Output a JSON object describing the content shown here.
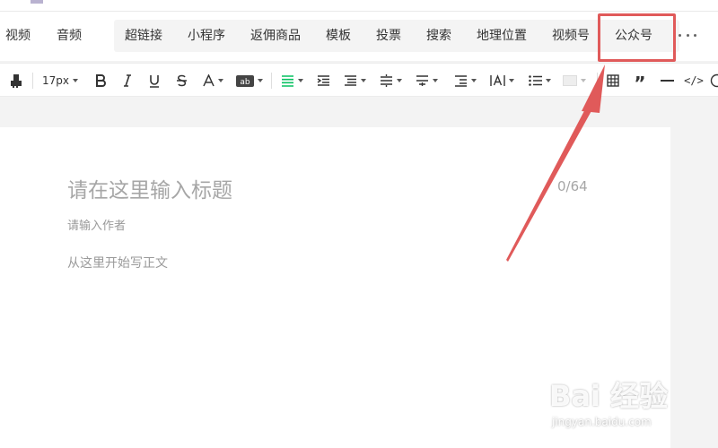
{
  "insert_bar": {
    "items_left": [
      "视频",
      "音频"
    ],
    "items": [
      "超链接",
      "小程序",
      "返佣商品",
      "模板",
      "投票",
      "搜索",
      "地理位置",
      "视频号",
      "公众号"
    ],
    "more_icon": "more-horizontal-icon",
    "highlight_color": "#e05a5a"
  },
  "format_bar": {
    "font_size": "17px",
    "buttons": [
      "format-painter-icon",
      "bold-icon",
      "italic-icon",
      "underline-icon",
      "strikethrough-icon",
      "font-color-icon",
      "background-color-icon",
      "align-icon",
      "indent-icon",
      "line-height-icon",
      "paragraph-spacing-icon",
      "letter-spacing-icon",
      "list-icon",
      "table-icon",
      "quote-icon",
      "divider-icon",
      "code-icon"
    ],
    "accent_color": "#07c160"
  },
  "editor": {
    "title_placeholder": "请在这里输入标题",
    "title_counter": "0/64",
    "author_placeholder": "请输入作者",
    "body_placeholder": "从这里开始写正文"
  },
  "annotation": {
    "arrow_color": "#e05a5a"
  },
  "watermark": {
    "logo": "Bai 经验",
    "url": "jingyan.baidu.com"
  }
}
